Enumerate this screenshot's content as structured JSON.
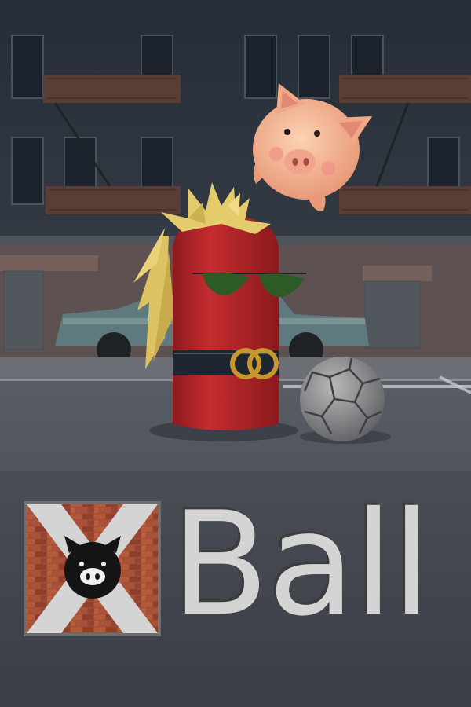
{
  "game": {
    "title_text": "Ball",
    "logo_letter": "X",
    "colors": {
      "sky_building": "#2c3440",
      "road": "#4a4e56",
      "bottle_red": "#b8262a",
      "belt": "#1e2630",
      "buckle_gold": "#c8962e",
      "pig_pink": "#f2b08e",
      "hair_blonde": "#e0c868",
      "ball_gray": "#8a8c90",
      "brick": "#9a4a34",
      "logo_x": "#d4d4d4",
      "title_fill": "#d4d4d4"
    },
    "icons": [
      "pig-face-icon",
      "brick-wall-icon"
    ]
  }
}
